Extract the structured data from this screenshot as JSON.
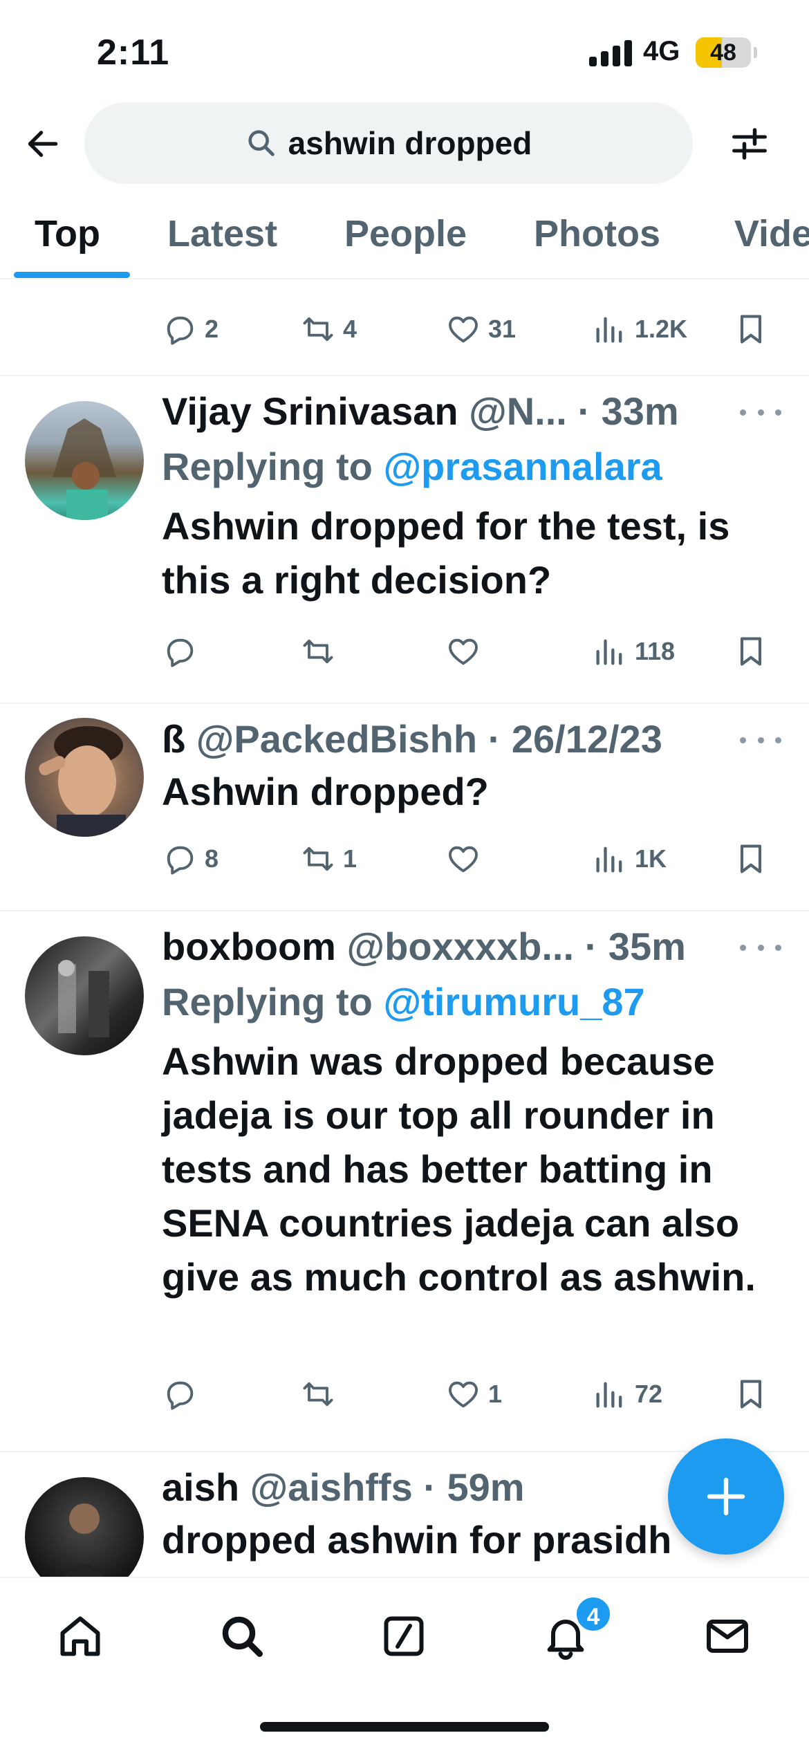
{
  "status_bar": {
    "time": "2:11",
    "network": "4G",
    "battery": "48"
  },
  "search": {
    "query": "ashwin dropped"
  },
  "tabs": [
    {
      "label": "Top",
      "active": true
    },
    {
      "label": "Latest"
    },
    {
      "label": "People"
    },
    {
      "label": "Photos"
    },
    {
      "label": "Videos"
    }
  ],
  "previous_tweet": {
    "replies": "2",
    "retweets": "4",
    "likes": "31",
    "views": "1.2K"
  },
  "tweets": [
    {
      "name": "Vijay Srinivasan",
      "meta": "@N... · 33m",
      "replying_label": "Replying to ",
      "replying_to": "@prasannalara",
      "text": "Ashwin dropped for the test, is this a right decision?",
      "replies": "",
      "retweets": "",
      "likes": "",
      "views": "118"
    },
    {
      "name": "ß",
      "meta": "@PackedBishh · 26/12/23",
      "text": "Ashwin dropped?",
      "replies": "8",
      "retweets": "1",
      "likes": "",
      "views": "1K"
    },
    {
      "name": "boxboom",
      "meta": "@boxxxxb... · 35m",
      "replying_label": "Replying to ",
      "replying_to": "@tirumuru_87",
      "text": "Ashwin was dropped because jadeja is our top all rounder in tests and has better batting in SENA countries jadeja can also give as much control as ashwin.",
      "replies": "",
      "retweets": "",
      "likes": "1",
      "views": "72"
    },
    {
      "name": "aish",
      "meta": "@aishffs · 59m",
      "text": "dropped ashwin for prasidh"
    }
  ],
  "nav": {
    "notifications_badge": "4"
  },
  "colors": {
    "accent": "#1d9bf0",
    "text": "#0f1419",
    "secondary": "#536471",
    "battery": "#f5c400"
  },
  "icons": [
    "back-arrow-icon",
    "search-icon",
    "filter-icon",
    "reply-icon",
    "retweet-icon",
    "like-icon",
    "views-icon",
    "bookmark-icon",
    "more-icon",
    "plus-icon",
    "home-icon",
    "explore-icon",
    "grok-icon",
    "bell-icon",
    "mail-icon"
  ]
}
